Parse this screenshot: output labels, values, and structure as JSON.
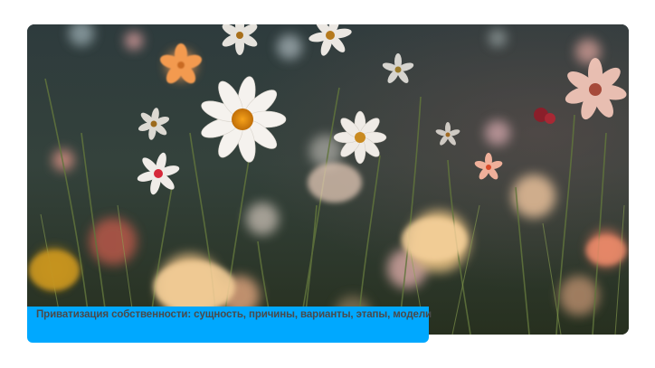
{
  "article": {
    "title": "Приватизация собственности: сущность, причины, варианты, этапы, модели"
  },
  "image": {
    "subject": "flower-field-photo"
  },
  "colors": {
    "caption_background": "#00a8ff",
    "caption_text": "#4a4a4a",
    "page_background": "#ffffff"
  }
}
